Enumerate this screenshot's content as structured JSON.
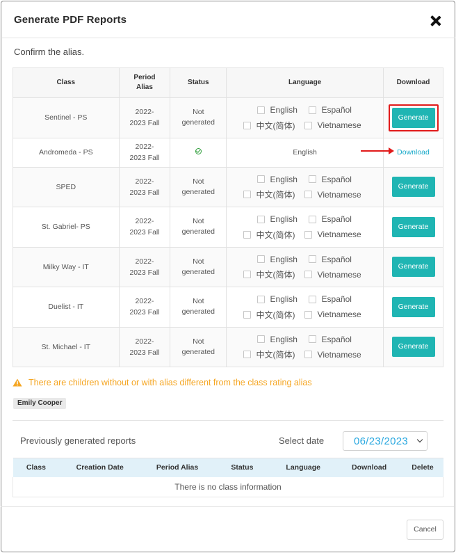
{
  "dialog": {
    "title": "Generate PDF Reports",
    "confirm_text": "Confirm the alias.",
    "cancel_label": "Cancel"
  },
  "table": {
    "headers": {
      "class": "Class",
      "period_alias_line1": "Period",
      "period_alias_line2": "Alias",
      "status": "Status",
      "language": "Language",
      "download": "Download"
    },
    "language_options": [
      "English",
      "Español",
      "中文(简体)",
      "Vietnamese"
    ],
    "rows": [
      {
        "class": "Sentinel - PS",
        "period_line1": "2022-",
        "period_line2": "2023 Fall",
        "status_line1": "Not",
        "status_line2": "generated",
        "action": "Generate"
      },
      {
        "class": "Andromeda - PS",
        "period_line1": "2022-",
        "period_line2": "2023 Fall",
        "status_icon": "check-circle-icon",
        "language": "English",
        "action": "Download"
      },
      {
        "class": "SPED",
        "period_line1": "2022-",
        "period_line2": "2023 Fall",
        "status_line1": "Not",
        "status_line2": "generated",
        "action": "Generate"
      },
      {
        "class": "St. Gabriel- PS",
        "period_line1": "2022-",
        "period_line2": "2023 Fall",
        "status_line1": "Not",
        "status_line2": "generated",
        "action": "Generate"
      },
      {
        "class": "Milky Way - IT",
        "period_line1": "2022-",
        "period_line2": "2023 Fall",
        "status_line1": "Not",
        "status_line2": "generated",
        "action": "Generate"
      },
      {
        "class": "Duelist - IT",
        "period_line1": "2022-",
        "period_line2": "2023 Fall",
        "status_line1": "Not",
        "status_line2": "generated",
        "action": "Generate"
      },
      {
        "class": "St. Michael - IT",
        "period_line1": "2022-",
        "period_line2": "2023 Fall",
        "status_line1": "Not",
        "status_line2": "generated",
        "action": "Generate"
      }
    ]
  },
  "warning": {
    "text": "There are children without or with alias different from the class rating alias",
    "icon": "warning-triangle-icon"
  },
  "child_tag": "Emily Cooper",
  "previous": {
    "title": "Previously generated reports",
    "select_date_label": "Select date",
    "selected_date": "06/23/2023",
    "headers": [
      "Class",
      "Creation Date",
      "Period Alias",
      "Status",
      "Language",
      "Download",
      "Delete"
    ],
    "empty_text": "There is no class information"
  },
  "colors": {
    "accent": "#1fb5b3",
    "link": "#17a9c9",
    "warning": "#f5a623",
    "highlight": "#e11b1b",
    "header_bg_secondary": "#e1f1f9"
  }
}
